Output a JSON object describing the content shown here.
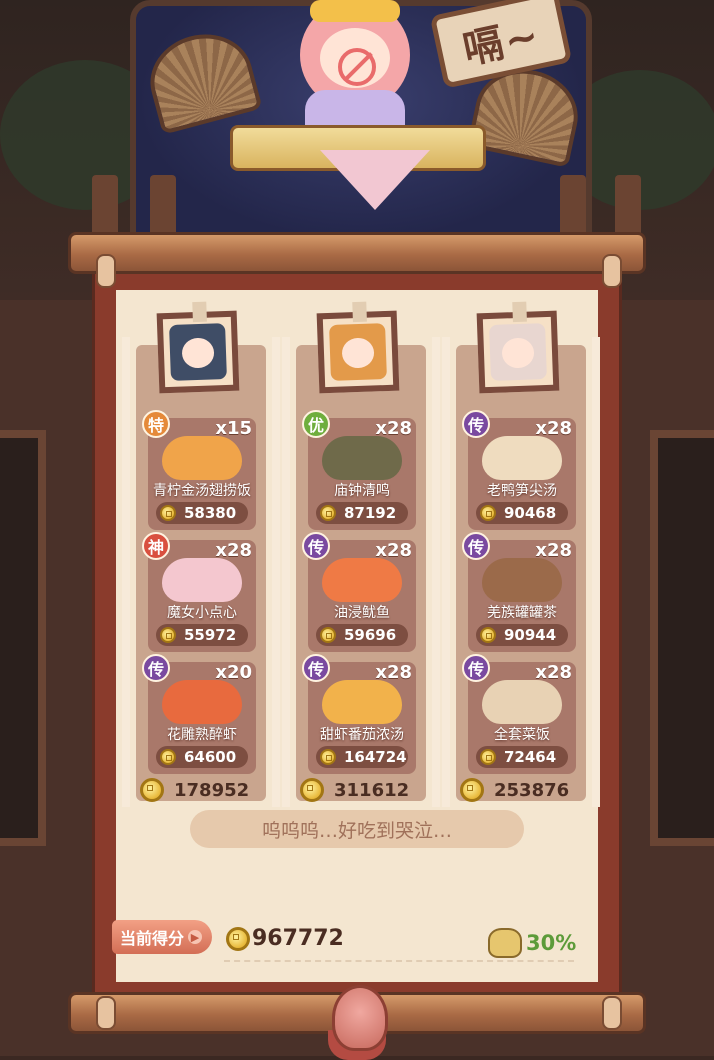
{
  "scene": {
    "sign_text": "嗝~",
    "icons": [
      "fan-icon",
      "no-food-icon",
      "crown-icon",
      "knot-icon"
    ]
  },
  "columns": [
    {
      "portrait_color": "#3f4d66",
      "dishes": [
        {
          "badge": "特",
          "badge_color": "#e58a3a",
          "qty": "x15",
          "name": "青柠金汤翅捞饭",
          "score": "58380",
          "food_color": "#f0a44a"
        },
        {
          "badge": "神",
          "badge_color": "#d9503f",
          "qty": "x28",
          "name": "魔女小点心",
          "score": "55972",
          "food_color": "#f4c7cf"
        },
        {
          "badge": "传",
          "badge_color": "#7a4aa0",
          "qty": "x20",
          "name": "花雕熟醉虾",
          "score": "64600",
          "food_color": "#e86a3e"
        }
      ],
      "total": "178952"
    },
    {
      "portrait_color": "#e39a4a",
      "dishes": [
        {
          "badge": "优",
          "badge_color": "#6fae3d",
          "qty": "x28",
          "name": "庙钟清鸣",
          "score": "87192",
          "food_color": "#6f6a4a"
        },
        {
          "badge": "传",
          "badge_color": "#7a4aa0",
          "qty": "x28",
          "name": "油浸鱿鱼",
          "score": "59696",
          "food_color": "#ef7a45"
        },
        {
          "badge": "传",
          "badge_color": "#7a4aa0",
          "qty": "x28",
          "name": "甜虾番茄浓汤",
          "score": "164724",
          "food_color": "#f2b24b"
        }
      ],
      "total": "311612"
    },
    {
      "portrait_color": "#e8d6d0",
      "dishes": [
        {
          "badge": "传",
          "badge_color": "#7a4aa0",
          "qty": "x28",
          "name": "老鸭笋尖汤",
          "score": "90468",
          "food_color": "#efdcbf"
        },
        {
          "badge": "传",
          "badge_color": "#7a4aa0",
          "qty": "x28",
          "name": "羌族罐罐茶",
          "score": "90944",
          "food_color": "#9b6a4a"
        },
        {
          "badge": "传",
          "badge_color": "#7a4aa0",
          "qty": "x28",
          "name": "全套菜饭",
          "score": "72464",
          "food_color": "#e8d2b4"
        }
      ],
      "total": "253876"
    }
  ],
  "comment": "呜呜呜…好吃到哭泣…",
  "footer": {
    "score_label": "当前得分",
    "current_score": "967772",
    "percent": "30%"
  }
}
